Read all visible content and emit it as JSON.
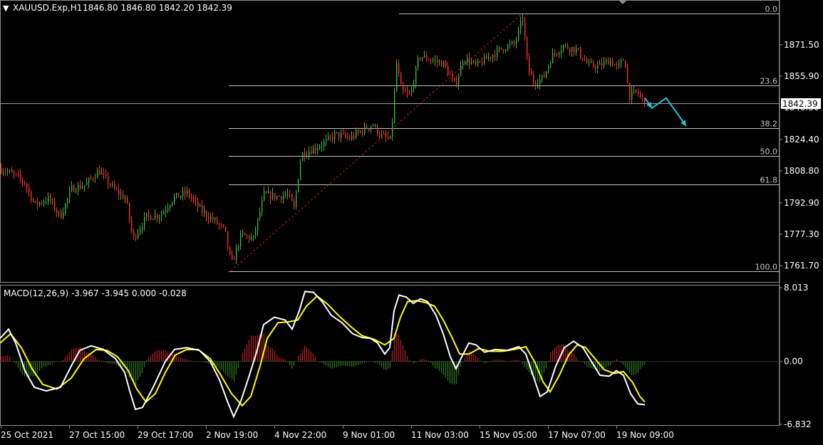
{
  "symbol_header": {
    "symbol": "XAUUSD.Exp,H1",
    "ohlc": "1846.80 1846.80 1842.20 1842.39",
    "menu_glyph": "▼"
  },
  "price_axis": {
    "ticks": [
      "1871.50",
      "1855.90",
      "1840.30",
      "1824.40",
      "1808.80",
      "1792.90",
      "1777.30",
      "1761.70"
    ],
    "current_price": "1842.39"
  },
  "fibonacci": {
    "levels": [
      {
        "label": "0.0",
        "price": 1887.0
      },
      {
        "label": "23.6",
        "price": 1851.3
      },
      {
        "label": "38.2",
        "price": 1830.0
      },
      {
        "label": "50.0",
        "price": 1816.3
      },
      {
        "label": "61.8",
        "price": 1802.1
      },
      {
        "label": "100.0",
        "price": 1758.9
      }
    ]
  },
  "macd_panel": {
    "label": "MACD(12,26,9) -3.967 -3.945 0.000 -0.028",
    "ticks": [
      "8.013",
      "0.00",
      "-6.832"
    ]
  },
  "time_axis": {
    "labels": [
      "25 Oct 2021",
      "27 Oct 15:00",
      "29 Oct 17:00",
      "2 Nov 19:00",
      "4 Nov 22:00",
      "9 Nov 01:00",
      "11 Nov 03:00",
      "15 Nov 05:00",
      "17 Nov 07:00",
      "19 Nov 09:00"
    ]
  },
  "colors": {
    "background": "#000000",
    "bull": "#3cb54a",
    "bear": "#ff3030",
    "grid_line": "#c0c0c0",
    "trend_line": "#cc2222",
    "projection_arrow": "#1cc8d8",
    "macd_line": "#ffffff",
    "signal_line": "#ffff00",
    "hist_pos": "#a02020",
    "hist_neg": "#2d6b1e"
  },
  "chart_data": [
    {
      "type": "candlestick",
      "title": "XAUUSD.Exp,H1",
      "y_range": [
        1755,
        1893
      ],
      "time_labels": [
        "25 Oct 2021",
        "27 Oct 15:00",
        "29 Oct 17:00",
        "2 Nov 19:00",
        "4 Nov 22:00",
        "9 Nov 01:00",
        "11 Nov 03:00",
        "15 Nov 05:00",
        "17 Nov 07:00",
        "19 Nov 09:00"
      ],
      "close_path": [
        {
          "x": 0,
          "y": 1810
        },
        {
          "x": 23,
          "y": 1806
        },
        {
          "x": 34,
          "y": 1803
        },
        {
          "x": 48,
          "y": 1792
        },
        {
          "x": 68,
          "y": 1795
        },
        {
          "x": 84,
          "y": 1786
        },
        {
          "x": 100,
          "y": 1800
        },
        {
          "x": 120,
          "y": 1802
        },
        {
          "x": 138,
          "y": 1809
        },
        {
          "x": 158,
          "y": 1800
        },
        {
          "x": 176,
          "y": 1795
        },
        {
          "x": 186,
          "y": 1775
        },
        {
          "x": 205,
          "y": 1786
        },
        {
          "x": 225,
          "y": 1787
        },
        {
          "x": 242,
          "y": 1795
        },
        {
          "x": 262,
          "y": 1798
        },
        {
          "x": 282,
          "y": 1789
        },
        {
          "x": 300,
          "y": 1784
        },
        {
          "x": 315,
          "y": 1779
        },
        {
          "x": 324,
          "y": 1762
        },
        {
          "x": 338,
          "y": 1777
        },
        {
          "x": 355,
          "y": 1775
        },
        {
          "x": 370,
          "y": 1797
        },
        {
          "x": 388,
          "y": 1796
        },
        {
          "x": 404,
          "y": 1797
        },
        {
          "x": 412,
          "y": 1790
        },
        {
          "x": 422,
          "y": 1817
        },
        {
          "x": 440,
          "y": 1820
        },
        {
          "x": 456,
          "y": 1823
        },
        {
          "x": 470,
          "y": 1827
        },
        {
          "x": 490,
          "y": 1825
        },
        {
          "x": 508,
          "y": 1829
        },
        {
          "x": 522,
          "y": 1832
        },
        {
          "x": 535,
          "y": 1826
        },
        {
          "x": 548,
          "y": 1824
        },
        {
          "x": 556,
          "y": 1862
        },
        {
          "x": 563,
          "y": 1848
        },
        {
          "x": 575,
          "y": 1846
        },
        {
          "x": 588,
          "y": 1866
        },
        {
          "x": 604,
          "y": 1864
        },
        {
          "x": 622,
          "y": 1862
        },
        {
          "x": 638,
          "y": 1851
        },
        {
          "x": 650,
          "y": 1865
        },
        {
          "x": 668,
          "y": 1861
        },
        {
          "x": 688,
          "y": 1866
        },
        {
          "x": 706,
          "y": 1870
        },
        {
          "x": 722,
          "y": 1872
        },
        {
          "x": 733,
          "y": 1885
        },
        {
          "x": 740,
          "y": 1860
        },
        {
          "x": 748,
          "y": 1853
        },
        {
          "x": 762,
          "y": 1855
        },
        {
          "x": 774,
          "y": 1866
        },
        {
          "x": 790,
          "y": 1871
        },
        {
          "x": 808,
          "y": 1869
        },
        {
          "x": 826,
          "y": 1861
        },
        {
          "x": 842,
          "y": 1861
        },
        {
          "x": 855,
          "y": 1864
        },
        {
          "x": 866,
          "y": 1860
        },
        {
          "x": 876,
          "y": 1865
        },
        {
          "x": 882,
          "y": 1846
        },
        {
          "x": 893,
          "y": 1848
        },
        {
          "x": 905,
          "y": 1842.4
        }
      ],
      "current_price": 1842.39,
      "trend_line": {
        "from": {
          "x": 324,
          "y": 1759
        },
        "to": {
          "x": 733,
          "y": 1887
        }
      },
      "projection_path": [
        {
          "x": 905,
          "y": 1845
        },
        {
          "x": 915,
          "y": 1840
        },
        {
          "x": 935,
          "y": 1845
        },
        {
          "x": 963,
          "y": 1831
        }
      ]
    },
    {
      "type": "line",
      "title": "MACD(12,26,9)",
      "y_range": [
        -6.832,
        8.013
      ],
      "series": [
        {
          "name": "MACD",
          "values": [
            {
              "x": 0,
              "y": 2.5
            },
            {
              "x": 12,
              "y": 3.5
            },
            {
              "x": 22,
              "y": 2.0
            },
            {
              "x": 35,
              "y": -1.0
            },
            {
              "x": 48,
              "y": -2.8
            },
            {
              "x": 65,
              "y": -3.2
            },
            {
              "x": 85,
              "y": -2.8
            },
            {
              "x": 100,
              "y": -0.5
            },
            {
              "x": 112,
              "y": 1.2
            },
            {
              "x": 128,
              "y": 1.7
            },
            {
              "x": 145,
              "y": 1.3
            },
            {
              "x": 162,
              "y": 0.3
            },
            {
              "x": 175,
              "y": -1.2
            },
            {
              "x": 182,
              "y": -3.2
            },
            {
              "x": 190,
              "y": -5.2
            },
            {
              "x": 200,
              "y": -5.0
            },
            {
              "x": 215,
              "y": -2.8
            },
            {
              "x": 232,
              "y": 0.0
            },
            {
              "x": 245,
              "y": 1.3
            },
            {
              "x": 262,
              "y": 1.5
            },
            {
              "x": 280,
              "y": 1.2
            },
            {
              "x": 295,
              "y": 0.0
            },
            {
              "x": 308,
              "y": -2.0
            },
            {
              "x": 320,
              "y": -4.5
            },
            {
              "x": 328,
              "y": -6.0
            },
            {
              "x": 338,
              "y": -4.3
            },
            {
              "x": 350,
              "y": -1.5
            },
            {
              "x": 360,
              "y": 1.0
            },
            {
              "x": 370,
              "y": 4.0
            },
            {
              "x": 385,
              "y": 4.8
            },
            {
              "x": 400,
              "y": 4.5
            },
            {
              "x": 410,
              "y": 3.5
            },
            {
              "x": 420,
              "y": 5.5
            },
            {
              "x": 428,
              "y": 7.6
            },
            {
              "x": 440,
              "y": 7.5
            },
            {
              "x": 452,
              "y": 6.5
            },
            {
              "x": 465,
              "y": 5.0
            },
            {
              "x": 480,
              "y": 4.2
            },
            {
              "x": 495,
              "y": 3.0
            },
            {
              "x": 508,
              "y": 2.6
            },
            {
              "x": 520,
              "y": 2.5
            },
            {
              "x": 530,
              "y": 2.0
            },
            {
              "x": 540,
              "y": 0.8
            },
            {
              "x": 547,
              "y": 1.5
            },
            {
              "x": 553,
              "y": 5.5
            },
            {
              "x": 560,
              "y": 7.2
            },
            {
              "x": 570,
              "y": 7.0
            },
            {
              "x": 580,
              "y": 6.3
            },
            {
              "x": 590,
              "y": 6.8
            },
            {
              "x": 600,
              "y": 6.5
            },
            {
              "x": 612,
              "y": 5.0
            },
            {
              "x": 622,
              "y": 3.0
            },
            {
              "x": 632,
              "y": 0.5
            },
            {
              "x": 640,
              "y": -0.8
            },
            {
              "x": 648,
              "y": 0.5
            },
            {
              "x": 658,
              "y": 2.0
            },
            {
              "x": 668,
              "y": 1.8
            },
            {
              "x": 680,
              "y": 1.0
            },
            {
              "x": 695,
              "y": 1.3
            },
            {
              "x": 712,
              "y": 1.2
            },
            {
              "x": 728,
              "y": 1.6
            },
            {
              "x": 738,
              "y": 0.8
            },
            {
              "x": 748,
              "y": -1.5
            },
            {
              "x": 758,
              "y": -3.8
            },
            {
              "x": 768,
              "y": -3.3
            },
            {
              "x": 780,
              "y": -0.5
            },
            {
              "x": 792,
              "y": 1.5
            },
            {
              "x": 805,
              "y": 2.2
            },
            {
              "x": 818,
              "y": 1.5
            },
            {
              "x": 830,
              "y": 0.0
            },
            {
              "x": 842,
              "y": -1.5
            },
            {
              "x": 855,
              "y": -1.6
            },
            {
              "x": 865,
              "y": -1.0
            },
            {
              "x": 875,
              "y": -1.5
            },
            {
              "x": 885,
              "y": -3.5
            },
            {
              "x": 895,
              "y": -4.6
            },
            {
              "x": 905,
              "y": -4.7
            }
          ]
        },
        {
          "name": "Signal",
          "values": [
            {
              "x": 0,
              "y": 2.0
            },
            {
              "x": 15,
              "y": 3.0
            },
            {
              "x": 30,
              "y": 1.5
            },
            {
              "x": 45,
              "y": -0.8
            },
            {
              "x": 60,
              "y": -2.5
            },
            {
              "x": 80,
              "y": -3.0
            },
            {
              "x": 100,
              "y": -1.8
            },
            {
              "x": 118,
              "y": 0.3
            },
            {
              "x": 135,
              "y": 1.3
            },
            {
              "x": 150,
              "y": 1.2
            },
            {
              "x": 165,
              "y": 0.5
            },
            {
              "x": 180,
              "y": -1.0
            },
            {
              "x": 192,
              "y": -3.0
            },
            {
              "x": 205,
              "y": -4.4
            },
            {
              "x": 218,
              "y": -3.5
            },
            {
              "x": 232,
              "y": -1.2
            },
            {
              "x": 246,
              "y": 0.7
            },
            {
              "x": 262,
              "y": 1.3
            },
            {
              "x": 278,
              "y": 1.3
            },
            {
              "x": 295,
              "y": 0.3
            },
            {
              "x": 310,
              "y": -1.5
            },
            {
              "x": 325,
              "y": -3.5
            },
            {
              "x": 340,
              "y": -4.8
            },
            {
              "x": 352,
              "y": -3.8
            },
            {
              "x": 365,
              "y": -0.5
            },
            {
              "x": 375,
              "y": 2.5
            },
            {
              "x": 390,
              "y": 4.2
            },
            {
              "x": 405,
              "y": 4.3
            },
            {
              "x": 418,
              "y": 4.5
            },
            {
              "x": 430,
              "y": 6.0
            },
            {
              "x": 445,
              "y": 7.1
            },
            {
              "x": 460,
              "y": 6.2
            },
            {
              "x": 475,
              "y": 5.0
            },
            {
              "x": 492,
              "y": 3.8
            },
            {
              "x": 508,
              "y": 2.8
            },
            {
              "x": 525,
              "y": 2.4
            },
            {
              "x": 540,
              "y": 1.8
            },
            {
              "x": 553,
              "y": 2.5
            },
            {
              "x": 562,
              "y": 4.8
            },
            {
              "x": 572,
              "y": 6.5
            },
            {
              "x": 585,
              "y": 6.6
            },
            {
              "x": 597,
              "y": 6.4
            },
            {
              "x": 610,
              "y": 6.0
            },
            {
              "x": 622,
              "y": 4.5
            },
            {
              "x": 635,
              "y": 2.5
            },
            {
              "x": 645,
              "y": 0.8
            },
            {
              "x": 658,
              "y": 0.8
            },
            {
              "x": 672,
              "y": 1.4
            },
            {
              "x": 688,
              "y": 1.1
            },
            {
              "x": 705,
              "y": 1.1
            },
            {
              "x": 722,
              "y": 1.3
            },
            {
              "x": 738,
              "y": 1.6
            },
            {
              "x": 750,
              "y": 0.0
            },
            {
              "x": 762,
              "y": -2.2
            },
            {
              "x": 772,
              "y": -3.3
            },
            {
              "x": 785,
              "y": -1.5
            },
            {
              "x": 798,
              "y": 0.7
            },
            {
              "x": 810,
              "y": 1.8
            },
            {
              "x": 822,
              "y": 1.5
            },
            {
              "x": 835,
              "y": 0.3
            },
            {
              "x": 848,
              "y": -0.9
            },
            {
              "x": 862,
              "y": -1.3
            },
            {
              "x": 875,
              "y": -1.1
            },
            {
              "x": 888,
              "y": -2.3
            },
            {
              "x": 898,
              "y": -3.8
            },
            {
              "x": 905,
              "y": -4.4
            }
          ]
        }
      ]
    }
  ]
}
